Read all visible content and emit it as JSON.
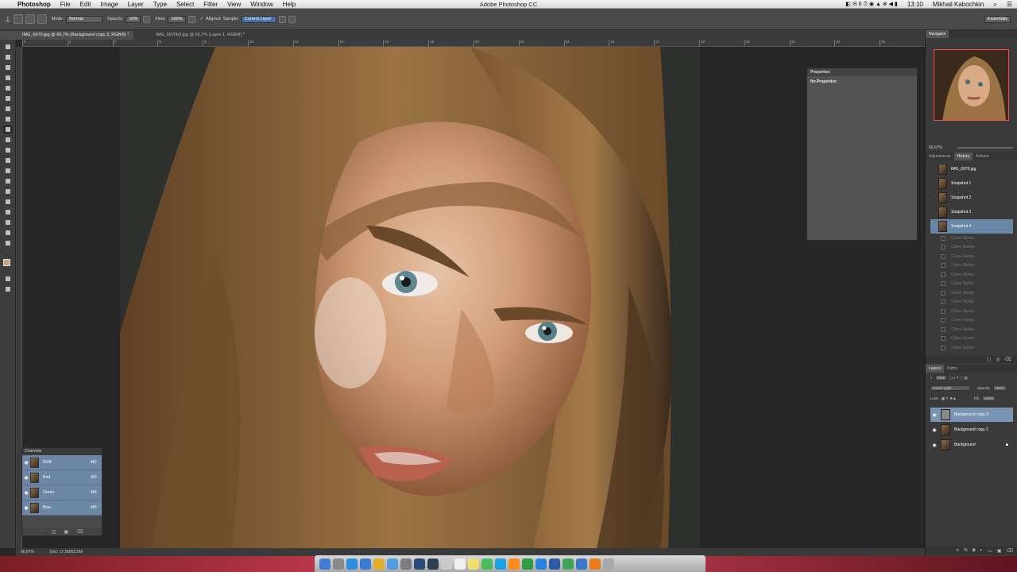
{
  "menubar": {
    "app": "Photoshop",
    "items": [
      "File",
      "Edit",
      "Image",
      "Layer",
      "Type",
      "Select",
      "Filter",
      "View",
      "Window",
      "Help"
    ],
    "window_title": "Adobe Photoshop CC",
    "clock": "13:10",
    "user": "Mikhail Kabochkin",
    "badge": "6"
  },
  "options": {
    "mode_label": "Mode:",
    "mode_value": "Normal",
    "opacity_label": "Opacity:",
    "opacity_value": "10%",
    "flow_label": "Flow:",
    "flow_value": "100%",
    "aligned_label": "Aligned",
    "sample_label": "Sample:",
    "sample_value": "Current Layer",
    "workspace": "Essentials"
  },
  "tabs": [
    "IMG_6970.jpg @ 66,7% (Background copy 3, RGB/8) *",
    "IMG_6970b3.jpg @ 66,7% (Layer 1, RGB/8) *"
  ],
  "ruler": [
    "0",
    "2",
    "4",
    "6",
    "8",
    "10",
    "12",
    "14",
    "16",
    "18",
    "20",
    "22",
    "24",
    "26",
    "27",
    "28",
    "29",
    "30",
    "31",
    "32"
  ],
  "status": {
    "zoom": "66,67%",
    "doc": "Doc: 17,5M/52,5M"
  },
  "channels": {
    "title": "Channels",
    "rows": [
      {
        "name": "RGB",
        "key": "⌘2"
      },
      {
        "name": "Red",
        "key": "⌘3"
      },
      {
        "name": "Green",
        "key": "⌘4"
      },
      {
        "name": "Blue",
        "key": "⌘5"
      }
    ]
  },
  "properties": {
    "title": "Properties",
    "body": "No Properties"
  },
  "navigator": {
    "title": "Navigator",
    "zoom": "66,67%"
  },
  "history": {
    "tabs": [
      "Adjustments",
      "History",
      "Actions"
    ],
    "source": "IMG_6970.jpg",
    "snapshots": [
      "Snapshot 1",
      "Snapshot 2",
      "Snapshot 3",
      "Snapshot 4"
    ],
    "steps": [
      "Clone Stamp",
      "Clone Stamp",
      "Clone Stamp",
      "Clone Stamp",
      "Clone Stamp",
      "Clone Stamp",
      "Clone Stamp",
      "Clone Stamp",
      "Clone Stamp",
      "Clone Stamp",
      "Clone Stamp",
      "Clone Stamp",
      "Clone Stamp"
    ]
  },
  "layers": {
    "tabs": [
      "Layers",
      "Paths"
    ],
    "kind": "Kind",
    "blend": "Linear Light",
    "opacity_label": "Opacity:",
    "opacity_value": "100%",
    "lock_label": "Lock:",
    "fill_label": "Fill:",
    "fill_value": "100%",
    "rows": [
      {
        "name": "Background copy 3"
      },
      {
        "name": "Background copy 2"
      },
      {
        "name": "Background"
      }
    ]
  },
  "colors": {
    "accent": "#6a86a6",
    "dock_red": "#b8364a"
  }
}
